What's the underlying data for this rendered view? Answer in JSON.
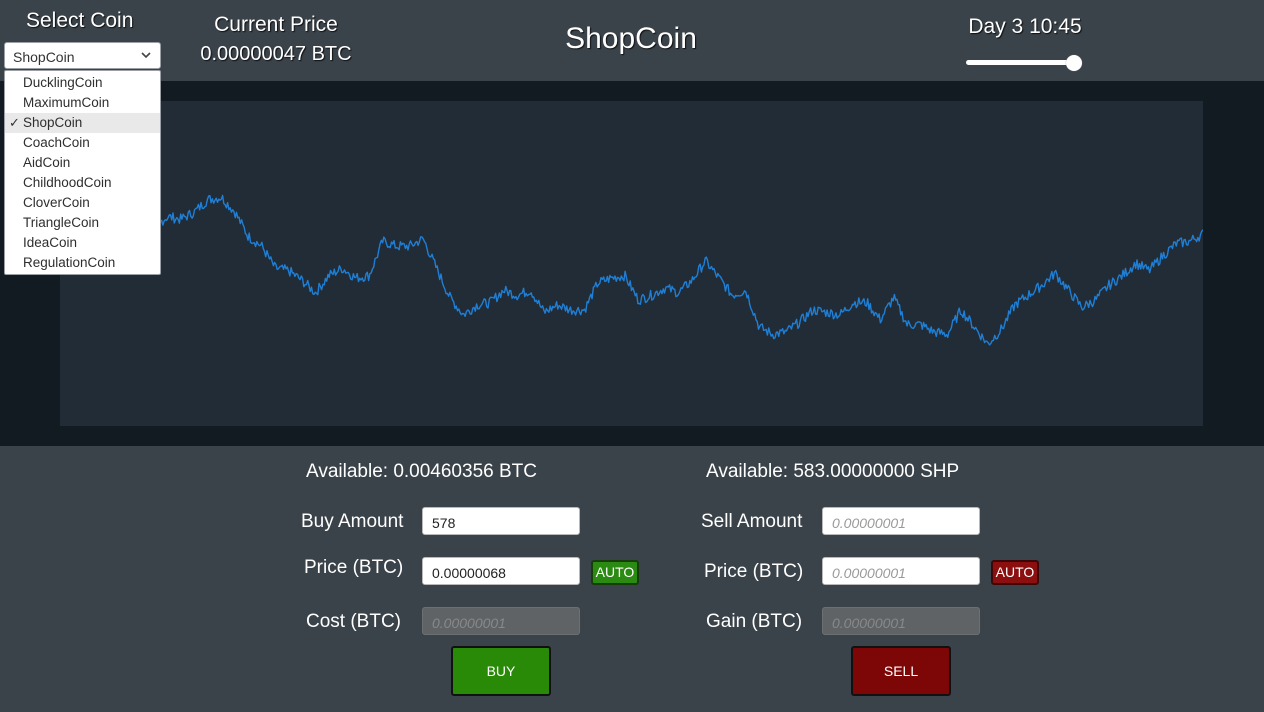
{
  "header": {
    "select_coin_label": "Select Coin",
    "selected_coin": "ShopCoin",
    "current_price_label": "Current Price",
    "current_price_value": "0.00000047 BTC",
    "title": "ShopCoin",
    "clock": "Day 3 10:45",
    "time_slider_value": 1.0
  },
  "coin_dropdown": {
    "items": [
      {
        "label": "DucklingCoin",
        "selected": false
      },
      {
        "label": "MaximumCoin",
        "selected": false
      },
      {
        "label": "ShopCoin",
        "selected": true
      },
      {
        "label": "CoachCoin",
        "selected": false
      },
      {
        "label": "AidCoin",
        "selected": false
      },
      {
        "label": "ChildhoodCoin",
        "selected": false
      },
      {
        "label": "CloverCoin",
        "selected": false
      },
      {
        "label": "TriangleCoin",
        "selected": false
      },
      {
        "label": "IdeaCoin",
        "selected": false
      },
      {
        "label": "RegulationCoin",
        "selected": false
      }
    ],
    "check_icon": "✓"
  },
  "chart_data": {
    "type": "line",
    "title": "",
    "xlabel": "",
    "ylabel": "",
    "grid": false,
    "color": "#1f7fd6",
    "background": "#212c36",
    "ylim": [
      0,
      100
    ],
    "series": [
      {
        "values": [
          62,
          72,
          82,
          89,
          84,
          68,
          62,
          61,
          65,
          64,
          67,
          72,
          73,
          67,
          57,
          53,
          44,
          43,
          39,
          34,
          41,
          44,
          40,
          41,
          55,
          53,
          53,
          56,
          44,
          32,
          25,
          29,
          30,
          35,
          33,
          35,
          26,
          29,
          27,
          27,
          38,
          40,
          41,
          31,
          33,
          36,
          34,
          39,
          47,
          40,
          33,
          35,
          20,
          17,
          18,
          22,
          27,
          26,
          25,
          30,
          30,
          23,
          32,
          21,
          21,
          18,
          17,
          27,
          20,
          13,
          19,
          29,
          33,
          37,
          42,
          35,
          28,
          31,
          37,
          41,
          46,
          43,
          49,
          54,
          55,
          58
        ]
      }
    ]
  },
  "buy_panel": {
    "available": "Available: 0.00460356 BTC",
    "amount_label": "Buy Amount",
    "amount_value": "578",
    "price_label": "Price (BTC)",
    "price_value": "0.00000068",
    "auto_label": "AUTO",
    "cost_label": "Cost (BTC)",
    "cost_placeholder": "0.00000001",
    "button_label": "BUY"
  },
  "sell_panel": {
    "available": "Available: 583.00000000 SHP",
    "amount_label": "Sell Amount",
    "amount_placeholder": "0.00000001",
    "price_label": "Price (BTC)",
    "price_placeholder": "0.00000001",
    "auto_label": "AUTO",
    "gain_label": "Gain (BTC)",
    "gain_placeholder": "0.00000001",
    "button_label": "SELL"
  }
}
